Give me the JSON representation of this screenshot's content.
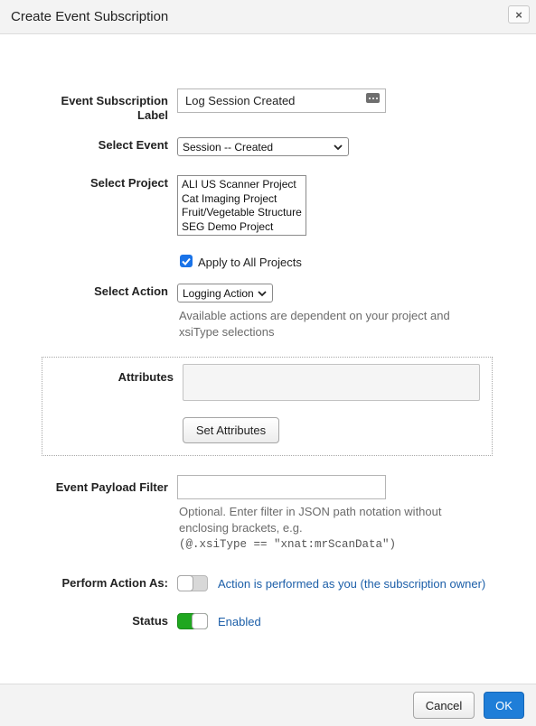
{
  "dialog": {
    "title": "Create Event Subscription",
    "close_label": "×"
  },
  "form": {
    "label_field": {
      "label_line1": "Event Subscription",
      "label_line2": "Label",
      "value": "Log Session Created"
    },
    "event": {
      "label": "Select Event",
      "selected": "Session -- Created"
    },
    "project": {
      "label": "Select Project",
      "options": [
        "ALI US Scanner Project",
        "Cat Imaging Project",
        "Fruit/Vegetable Structure",
        "SEG Demo Project"
      ]
    },
    "apply_all": {
      "label": "Apply to All Projects",
      "checked": true
    },
    "action": {
      "label": "Select Action",
      "selected": "Logging Action",
      "help_line1": "Available actions are dependent on your project and",
      "help_line2": "xsiType selections"
    },
    "attributes": {
      "label": "Attributes",
      "value": "",
      "button_label": "Set Attributes"
    },
    "payload_filter": {
      "label": "Event Payload Filter",
      "value": "",
      "help_line1": "Optional. Enter filter in JSON path notation without",
      "help_line2": "enclosing brackets, e.g.",
      "help_code": "(@.xsiType == \"xnat:mrScanData\")"
    },
    "perform_as": {
      "label": "Perform Action As:",
      "enabled": false,
      "text": "Action is performed as you (the subscription owner)"
    },
    "status": {
      "label": "Status",
      "enabled": true,
      "text": "Enabled"
    }
  },
  "footer": {
    "cancel_label": "Cancel",
    "ok_label": "OK"
  },
  "colors": {
    "accent": "#1f7ed8",
    "toggle_on": "#1fa71f",
    "link": "#1b5ea8"
  }
}
